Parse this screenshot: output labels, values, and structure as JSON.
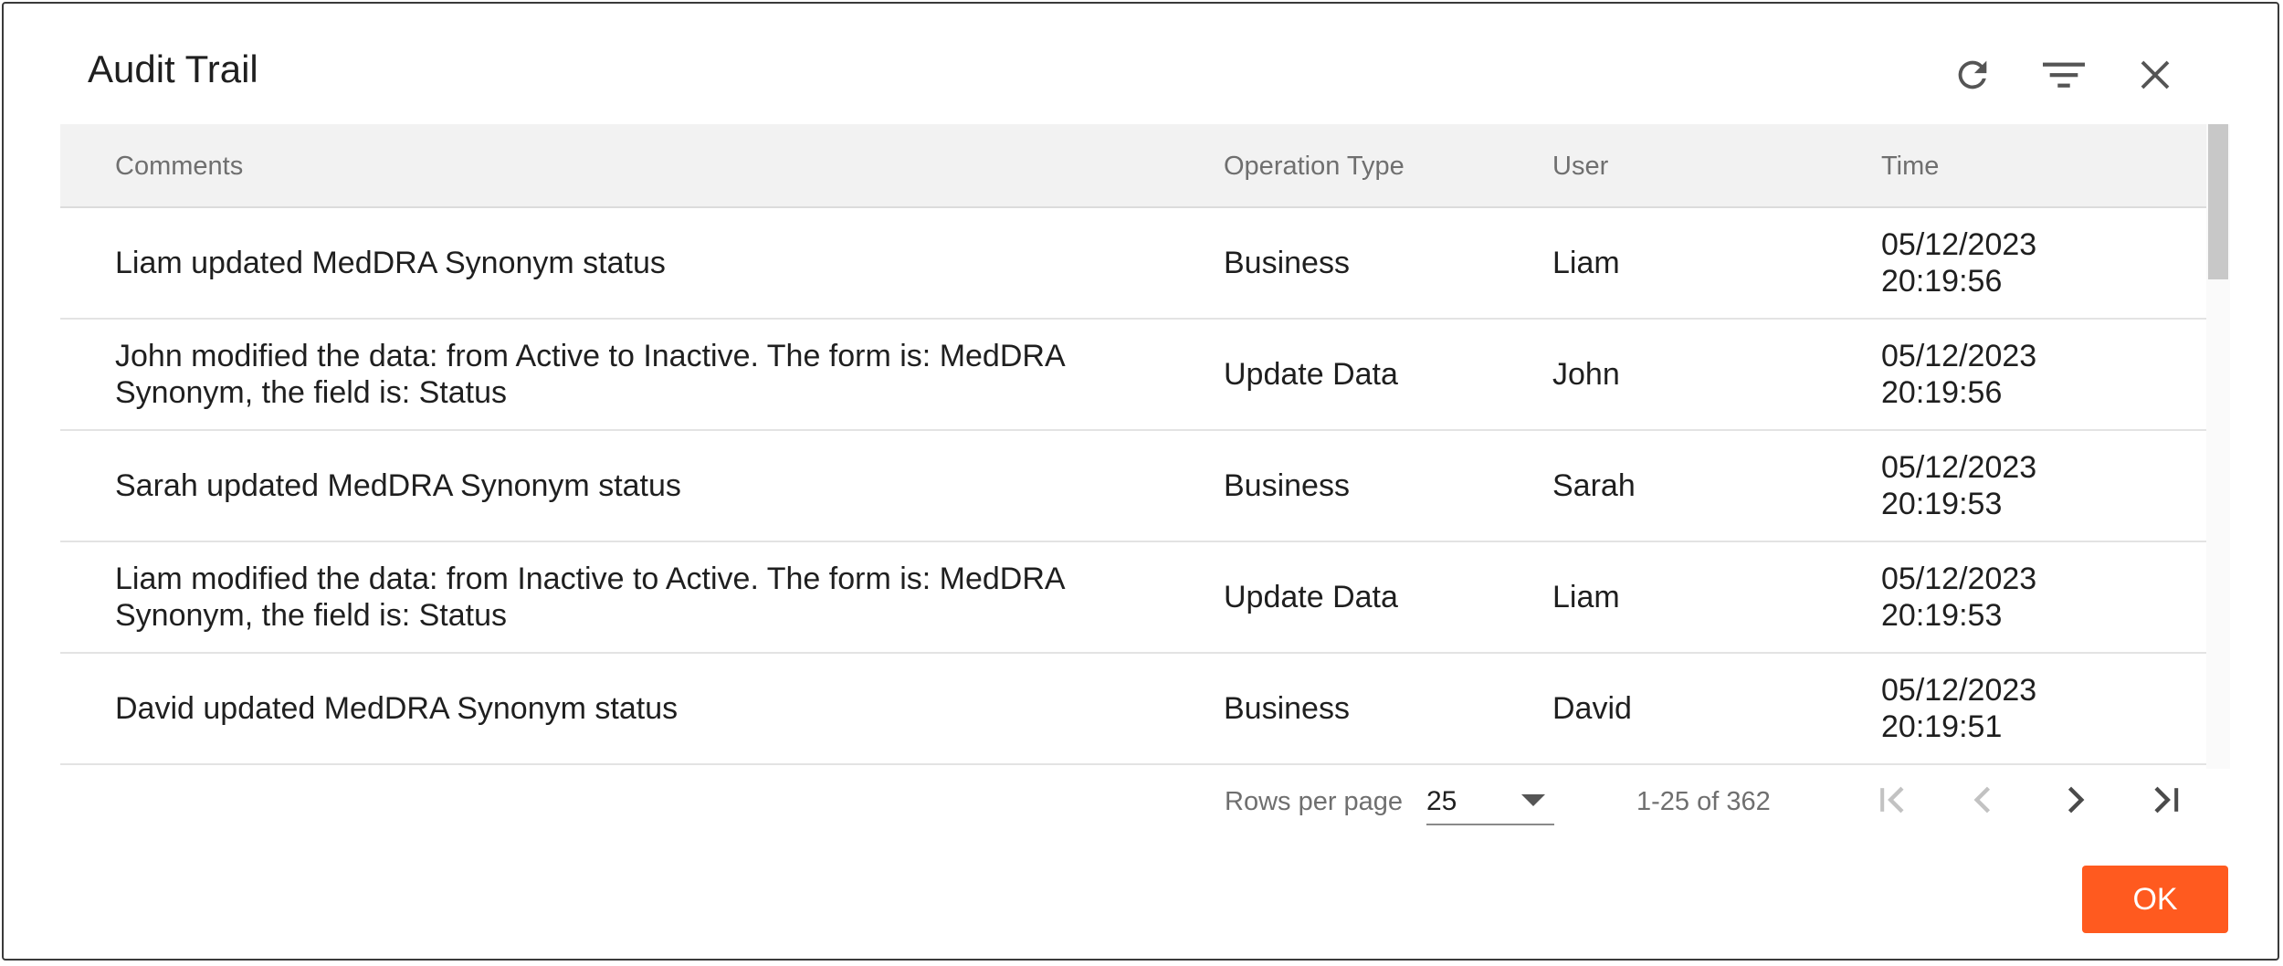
{
  "dialog": {
    "title": "Audit Trail",
    "toolbar": [
      {
        "icon": "refresh-icon"
      },
      {
        "icon": "filter-icon"
      },
      {
        "icon": "close-icon"
      }
    ]
  },
  "table": {
    "columns": {
      "comments": "Comments",
      "operation_type": "Operation Type",
      "user": "User",
      "time": "Time"
    },
    "rows": [
      {
        "comment": "Liam updated MedDRA Synonym status",
        "operation_type": "Business",
        "user": "Liam",
        "date": "05/12/2023",
        "clock": "20:19:56"
      },
      {
        "comment": "John modified the data: from Active to Inactive. The form is: MedDRA Synonym, the field is: Status",
        "operation_type": "Update Data",
        "user": "John",
        "date": "05/12/2023",
        "clock": "20:19:56"
      },
      {
        "comment": "Sarah updated MedDRA Synonym status",
        "operation_type": "Business",
        "user": "Sarah",
        "date": "05/12/2023",
        "clock": "20:19:53"
      },
      {
        "comment": "Liam modified the data: from Inactive to Active. The form is: MedDRA Synonym, the field is: Status",
        "operation_type": "Update Data",
        "user": "Liam",
        "date": "05/12/2023",
        "clock": "20:19:53"
      },
      {
        "comment": "David updated MedDRA Synonym status",
        "operation_type": "Business",
        "user": "David",
        "date": "05/12/2023",
        "clock": "20:19:51"
      }
    ]
  },
  "pagination": {
    "rows_per_page_label": "Rows per page",
    "rows_per_page_value": "25",
    "range_text": "1-25 of 362",
    "first_icon": "first-page-icon",
    "prev_icon": "chevron-left-icon",
    "next_icon": "chevron-right-icon",
    "last_icon": "last-page-icon"
  },
  "footer": {
    "ok_label": "OK",
    "ok_color": "#ff5a1f"
  }
}
